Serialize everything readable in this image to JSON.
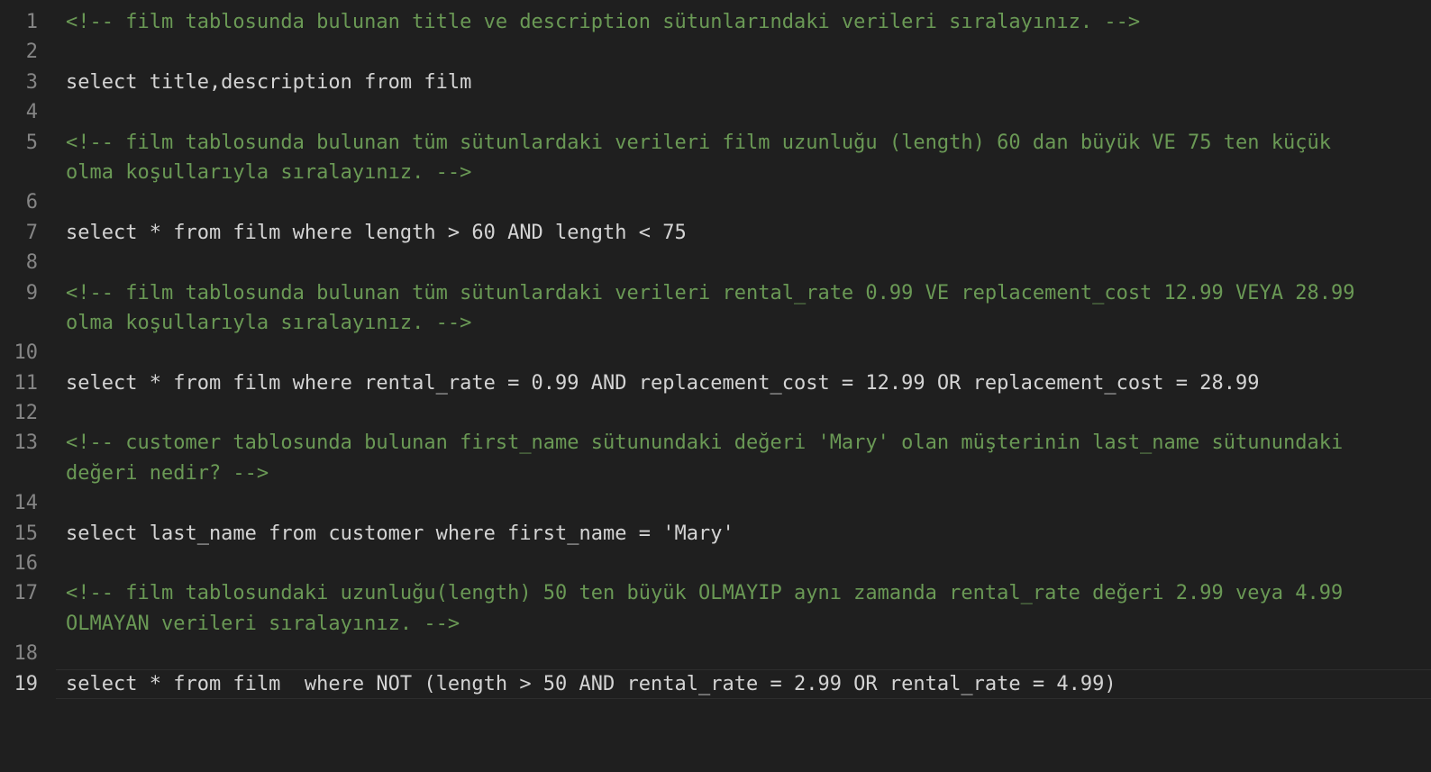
{
  "editor": {
    "lines": [
      {
        "num": "1",
        "kind": "comment",
        "text": "<!-- film tablosunda bulunan title ve description sütunlarındaki verileri sıralayınız. -->"
      },
      {
        "num": "2",
        "kind": "blank",
        "text": ""
      },
      {
        "num": "3",
        "kind": "plain",
        "text": "select title,description from film"
      },
      {
        "num": "4",
        "kind": "blank",
        "text": ""
      },
      {
        "num": "5",
        "kind": "comment",
        "text": "<!-- film tablosunda bulunan tüm sütunlardaki verileri film uzunluğu (length) 60 dan büyük VE 75 ten küçük"
      },
      {
        "num": "",
        "kind": "comment",
        "text": "olma koşullarıyla sıralayınız. -->"
      },
      {
        "num": "6",
        "kind": "blank",
        "text": ""
      },
      {
        "num": "7",
        "kind": "plain",
        "text": "select * from film where length > 60 AND length < 75"
      },
      {
        "num": "8",
        "kind": "blank",
        "text": ""
      },
      {
        "num": "9",
        "kind": "comment",
        "text": "<!-- film tablosunda bulunan tüm sütunlardaki verileri rental_rate 0.99 VE replacement_cost 12.99 VEYA 28.99"
      },
      {
        "num": "",
        "kind": "comment",
        "text": "olma koşullarıyla sıralayınız. -->"
      },
      {
        "num": "10",
        "kind": "blank",
        "text": ""
      },
      {
        "num": "11",
        "kind": "plain",
        "text": "select * from film where rental_rate = 0.99 AND replacement_cost = 12.99 OR replacement_cost = 28.99"
      },
      {
        "num": "12",
        "kind": "blank",
        "text": ""
      },
      {
        "num": "13",
        "kind": "comment",
        "text": "<!-- customer tablosunda bulunan first_name sütunundaki değeri 'Mary' olan müşterinin last_name sütunundaki"
      },
      {
        "num": "",
        "kind": "comment",
        "text": "değeri nedir? -->"
      },
      {
        "num": "14",
        "kind": "blank",
        "text": ""
      },
      {
        "num": "15",
        "kind": "plain",
        "text": "select last_name from customer where first_name = 'Mary'"
      },
      {
        "num": "16",
        "kind": "blank",
        "text": ""
      },
      {
        "num": "17",
        "kind": "comment",
        "text": "<!-- film tablosundaki uzunluğu(length) 50 ten büyük OLMAYIP aynı zamanda rental_rate değeri 2.99 veya 4.99"
      },
      {
        "num": "",
        "kind": "comment",
        "text": "OLMAYAN verileri sıralayınız. -->"
      },
      {
        "num": "18",
        "kind": "blank",
        "text": ""
      },
      {
        "num": "19",
        "kind": "plain",
        "active": true,
        "text": "select * from film  where NOT (length > 50 AND rental_rate = 2.99 OR rental_rate = 4.99)"
      }
    ]
  },
  "colors": {
    "background": "#1f1f1f",
    "comment": "#6a9955",
    "code": "#d4d4d4",
    "line_number": "#858585",
    "line_number_active": "#cccccc"
  }
}
